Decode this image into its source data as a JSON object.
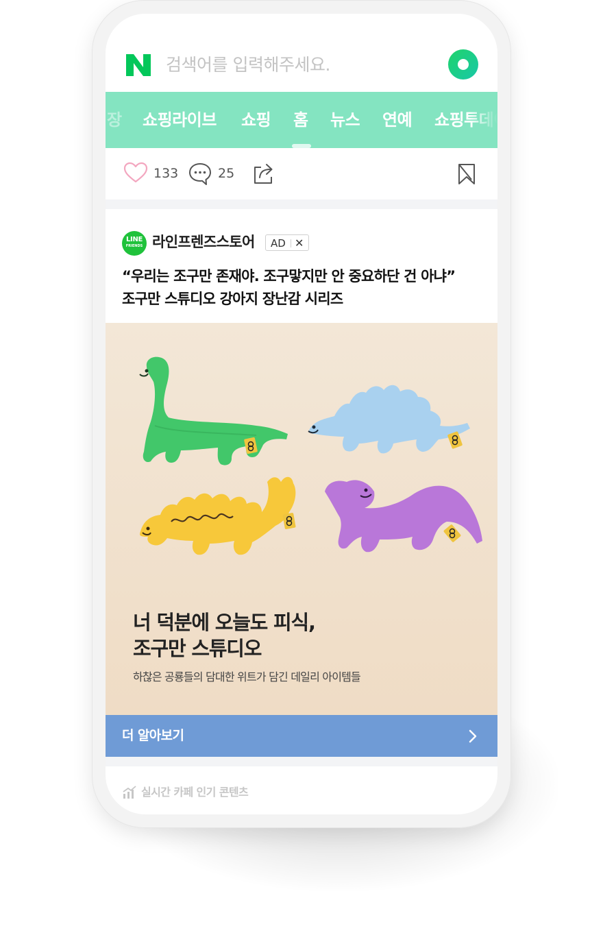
{
  "search": {
    "logo": "N",
    "placeholder": "검색어를 입력해주세요.",
    "action_icon": "green-circle-button"
  },
  "tabs": [
    {
      "label": "장",
      "active": false
    },
    {
      "label": "쇼핑라이브",
      "active": false
    },
    {
      "label": "쇼핑",
      "active": false
    },
    {
      "label": "홈",
      "active": true
    },
    {
      "label": "뉴스",
      "active": false
    },
    {
      "label": "연예",
      "active": false
    },
    {
      "label": "쇼핑투데이",
      "active": false
    }
  ],
  "reactions": {
    "likes": "133",
    "comments": "25",
    "icons": [
      "heart-icon",
      "comment-icon",
      "share-icon",
      "bookmark-icon"
    ]
  },
  "ad": {
    "logo_line1": "LINE",
    "logo_line2": "FRIENDS",
    "advertiser": "라인프렌즈스토어",
    "badge": "AD",
    "close": "✕",
    "headline_line1": "“우리는 조구만 존재야. 조구맣지만 안 중요하단 건 아냐”",
    "headline_line2": "조구만 스튜디오 강아지 장난감 시리즈",
    "banner_title_line1": "너 덕분에 오늘도 피식,",
    "banner_title_line2": "조구만 스튜디오",
    "banner_subtitle": "하찮은 공룡들의 담대한 위트가 담긴 데일리 아이템들",
    "cta_label": "더 알아보기"
  },
  "bottom": {
    "label": "실시간 카페 인기 콘텐츠"
  },
  "colors": {
    "naver_green": "#03c75a",
    "tab_bar": "#84e4c1",
    "cta": "#6f9bd6",
    "line_green": "#1fc23b",
    "heart_pink": "#f3a6bf"
  }
}
